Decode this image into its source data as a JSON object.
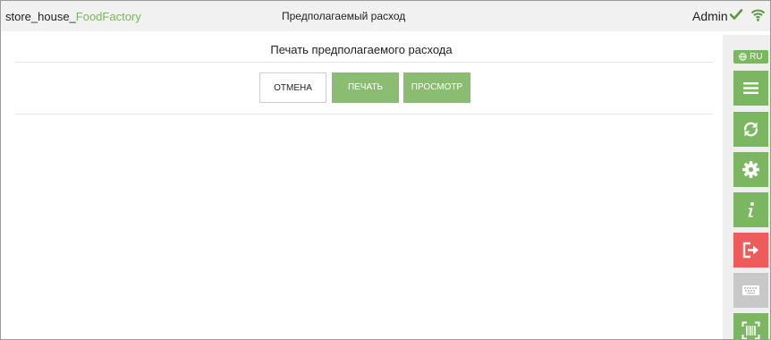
{
  "header": {
    "app_name_prefix": "store_house_",
    "app_name_accent": "FoodFactory",
    "page_title": "Предполагаемый расход",
    "user": "Admin"
  },
  "main": {
    "title": "Печать предполагаемого расхода",
    "cancel_label": "ОТМЕНА",
    "print_label": "ПЕЧАТЬ",
    "preview_label": "ПРОСМОТР"
  },
  "sidebar": {
    "language": "RU",
    "buttons": [
      "menu-icon",
      "sync-icon",
      "gear-icon",
      "info-icon",
      "logout-icon",
      "keyboard-icon",
      "barcode-scan-icon"
    ]
  },
  "colors": {
    "accent": "#7bb661",
    "button_green": "#8abd72",
    "logout_red": "#ef5b5b",
    "disabled_grey": "#c8c8c8"
  }
}
